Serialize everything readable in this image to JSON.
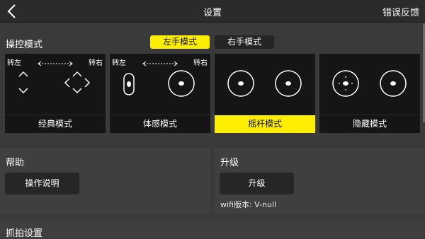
{
  "header": {
    "title": "设置",
    "feedback_label": "错误反馈"
  },
  "control_mode": {
    "label": "操控模式",
    "left_hand_label": "左手模式",
    "right_hand_label": "右手模式",
    "selected_hand": "左手模式",
    "turn_left": "转左",
    "turn_right": "转右",
    "modes": [
      {
        "label": "经典模式",
        "selected": false
      },
      {
        "label": "体感模式",
        "selected": false
      },
      {
        "label": "摇杆模式",
        "selected": true
      },
      {
        "label": "隐藏模式",
        "selected": false
      }
    ]
  },
  "help": {
    "title": "帮助",
    "button_label": "操作说明"
  },
  "upgrade": {
    "title": "升级",
    "button_label": "升级",
    "version_text": "wifi版本:  V-null"
  },
  "capture": {
    "title": "抓拍设置"
  },
  "colors": {
    "accent": "#ffee00",
    "background": "#3a3a3a",
    "card": "#151515"
  },
  "icons": [
    "back-arrow-icon",
    "arrow-icon",
    "joystick-icon"
  ]
}
